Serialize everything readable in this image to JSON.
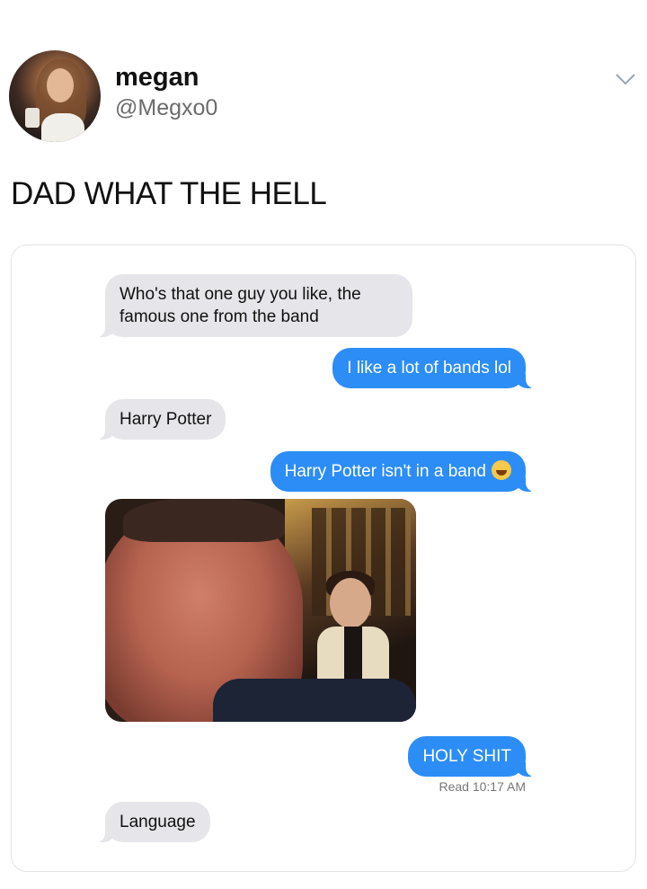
{
  "tweet": {
    "display_name": "megan",
    "handle": "@Megxo0",
    "text": "DAD WHAT THE HELL"
  },
  "messages": [
    {
      "from": "dad",
      "text": "Who's that one guy you like, the famous one from the band"
    },
    {
      "from": "me",
      "text": "I like a lot of bands lol"
    },
    {
      "from": "dad",
      "text": "Harry Potter"
    },
    {
      "from": "me",
      "text": "Harry Potter isn't in a band",
      "emoji": "laughing-emoji"
    },
    {
      "from": "dad",
      "type": "photo",
      "description_icon": "selfie-photo"
    },
    {
      "from": "me",
      "text": "HOLY SHIT"
    },
    {
      "from": "dad",
      "text": "Language"
    }
  ],
  "read_receipt": "Read 10:17 AM",
  "colors": {
    "sent_bubble": "#2c8df6",
    "received_bubble": "#e5e5ea",
    "handle_gray": "#6b6b6b"
  }
}
